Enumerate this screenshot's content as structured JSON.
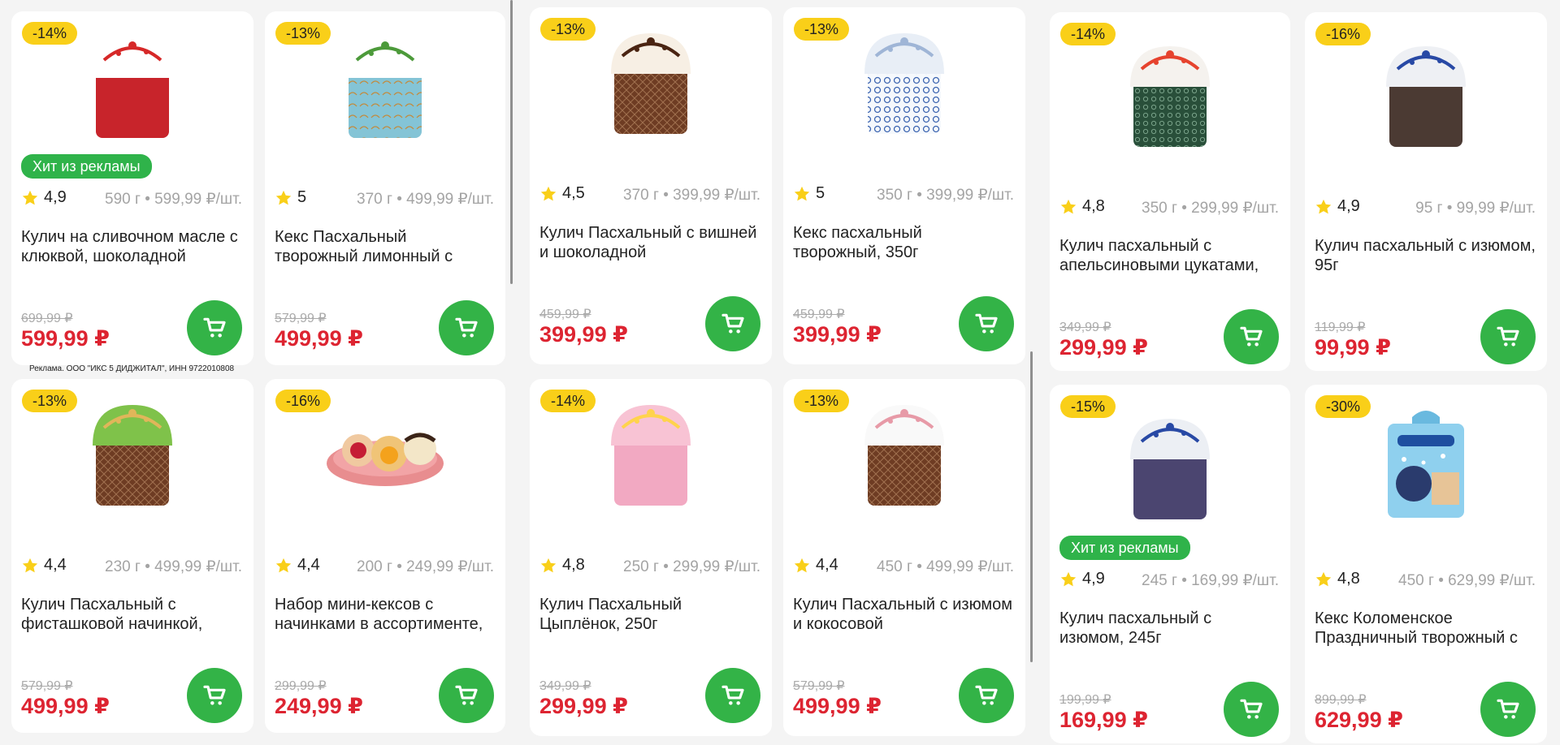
{
  "ad_disclaimer": "Реклама. ООО \"ИКС 5 ДИДЖИТАЛ\", ИНН 9722010808",
  "hit_label": "Хит из рекламы",
  "colors": {
    "accent": "#33b347",
    "price": "#dd2431",
    "badge": "#f9cf19"
  },
  "columns": [
    {
      "products": [
        {
          "discount": "-14%",
          "rating": "4,9",
          "weight": "590 г • 599,99 ₽/шт.",
          "title": "Кулич на сливочном масле с клюквой, шоколадной",
          "old_price": "699,99 ₽",
          "price": "599,99 ₽",
          "hit": true,
          "image": "kulich-red-rooster"
        },
        {
          "discount": "-13%",
          "rating": "4,4",
          "weight": "230 г • 499,99 ₽/шт.",
          "title": "Кулич Пасхальный с фисташковой начинкой,",
          "old_price": "579,99 ₽",
          "price": "499,99 ₽",
          "hit": false,
          "image": "kulich-pistachio"
        }
      ]
    },
    {
      "products": [
        {
          "discount": "-13%",
          "rating": "5",
          "weight": "370 г • 499,99 ₽/шт.",
          "title": "Кекс Пасхальный творожный лимонный с",
          "old_price": "579,99 ₽",
          "price": "499,99 ₽",
          "hit": false,
          "image": "keks-blue-egg"
        },
        {
          "discount": "-16%",
          "rating": "4,4",
          "weight": "200 г • 249,99 ₽/шт.",
          "title": "Набор мини-кексов с начинками в ассортименте,",
          "old_price": "299,99 ₽",
          "price": "249,99 ₽",
          "hit": false,
          "image": "mini-keks-plate"
        }
      ]
    },
    {
      "products": [
        {
          "discount": "-13%",
          "rating": "4,5",
          "weight": "370 г • 399,99 ₽/шт.",
          "title": "Кулич Пасхальный с вишней и шоколадной",
          "old_price": "459,99 ₽",
          "price": "399,99 ₽",
          "hit": false,
          "image": "kulich-chocolate"
        },
        {
          "discount": "-14%",
          "rating": "4,8",
          "weight": "250 г • 299,99 ₽/шт.",
          "title": "Кулич Пасхальный Цыплёнок, 250г",
          "old_price": "349,99 ₽",
          "price": "299,99 ₽",
          "hit": false,
          "image": "kulich-chick"
        }
      ]
    },
    {
      "products": [
        {
          "discount": "-13%",
          "rating": "5",
          "weight": "350 г • 399,99 ₽/шт.",
          "title": "Кекс пасхальный творожный, 350г",
          "old_price": "459,99 ₽",
          "price": "399,99 ₽",
          "hit": false,
          "image": "keks-blue-white"
        },
        {
          "discount": "-13%",
          "rating": "4,4",
          "weight": "450 г • 499,99 ₽/шт.",
          "title": "Кулич Пасхальный с изюмом и кокосовой",
          "old_price": "579,99 ₽",
          "price": "499,99 ₽",
          "hit": false,
          "image": "kulich-coconut"
        }
      ]
    },
    {
      "products": [
        {
          "discount": "-14%",
          "rating": "4,8",
          "weight": "350 г • 299,99 ₽/шт.",
          "title": "Кулич пасхальный с апельсиновыми цукатами,",
          "old_price": "349,99 ₽",
          "price": "299,99 ₽",
          "hit": false,
          "image": "kulich-green-orange"
        },
        {
          "discount": "-15%",
          "rating": "4,9",
          "weight": "245 г • 169,99 ₽/шт.",
          "title": "Кулич пасхальный с изюмом, 245г",
          "old_price": "199,99 ₽",
          "price": "169,99 ₽",
          "hit": true,
          "image": "kulich-bag-245"
        }
      ]
    },
    {
      "products": [
        {
          "discount": "-16%",
          "rating": "4,9",
          "weight": "95 г • 99,99 ₽/шт.",
          "title": "Кулич пасхальный с изюмом, 95г",
          "old_price": "119,99 ₽",
          "price": "99,99 ₽",
          "hit": false,
          "image": "kulich-bag-95"
        },
        {
          "discount": "-30%",
          "rating": "4,8",
          "weight": "450 г • 629,99 ₽/шт.",
          "title": "Кекс Коломенское Праздничный творожный с",
          "old_price": "899,99 ₽",
          "price": "629,99 ₽",
          "hit": false,
          "image": "keks-box"
        }
      ]
    }
  ]
}
